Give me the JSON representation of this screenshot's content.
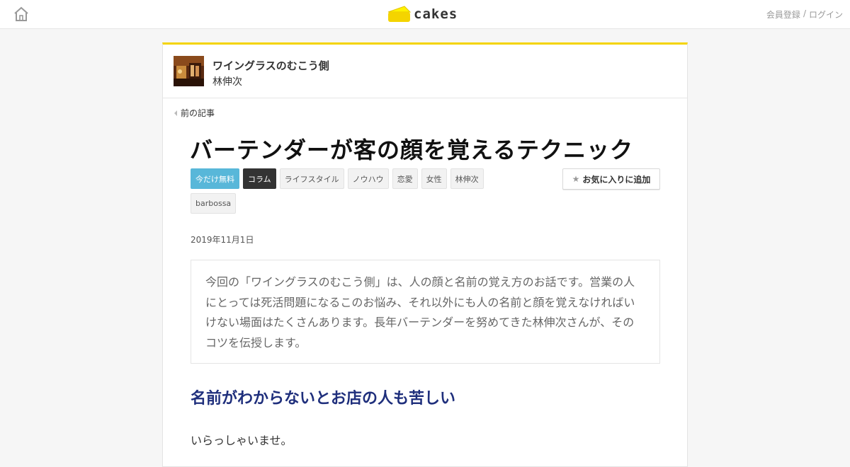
{
  "header": {
    "logo_text": "cakes",
    "signup_label": "会員登録",
    "separator": "/",
    "login_label": "ログイン"
  },
  "series": {
    "title": "ワイングラスのむこう側",
    "author": "林伸次"
  },
  "nav": {
    "prev_label": "前の記事"
  },
  "article": {
    "title": "バーテンダーが客の顔を覚えるテクニック",
    "tags": [
      "今だけ無料",
      "コラム",
      "ライフスタイル",
      "ノウハウ",
      "恋愛",
      "女性",
      "林伸次",
      "barbossa"
    ],
    "favorite_label": "お気に入りに追加",
    "date": "2019年11月1日",
    "lead": "今回の「ワイングラスのむこう側」は、人の顔と名前の覚え方のお話です。営業の人にとっては死活問題になるこのお悩み、それ以外にも人の名前と顔を覚えなければいけない場面はたくさんあります。長年バーテンダーを努めてきた林伸次さんが、そのコツを伝授します。",
    "heading": "名前がわからないとお店の人も苦しい",
    "first_line": "いらっしゃいませ。"
  },
  "colors": {
    "accent_yellow": "#f4d400",
    "free_tag": "#58b7d9",
    "heading_navy": "#1f2f7c"
  }
}
